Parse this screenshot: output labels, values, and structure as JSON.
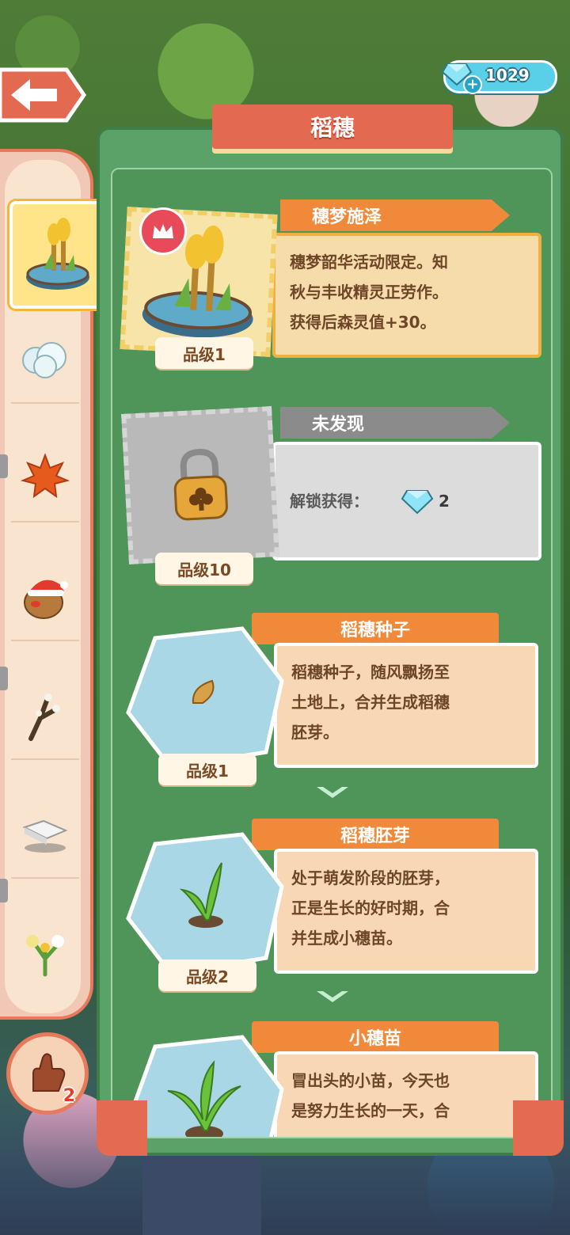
{
  "header": {
    "title": "稻穗",
    "currency_amount": "1029"
  },
  "back_button": {
    "icon": "back-arrow-icon"
  },
  "sidebar": {
    "categories": [
      {
        "name": "rice-ear-island",
        "active": true
      },
      {
        "name": "cotton"
      },
      {
        "name": "maple-leaf"
      },
      {
        "name": "christmas-potato"
      },
      {
        "name": "branch"
      },
      {
        "name": "white-block"
      },
      {
        "name": "flowers"
      }
    ],
    "hand_button_badge": "2"
  },
  "cards": [
    {
      "name": "穗梦施泽",
      "desc_lines": [
        "穗梦韶华活动限定。知",
        "秋与丰收精灵正劳作。",
        "获得后森灵值+30。"
      ],
      "grade": "品级1",
      "badge": "crown-icon",
      "style": "gold"
    },
    {
      "name": "未发现",
      "unlock_label": "解锁获得：",
      "unlock_amount": "2",
      "grade": "品级10",
      "style": "locked"
    },
    {
      "name": "稻穗种子",
      "desc_lines": [
        "稻穗种子，随风飘扬至",
        "土地上，合并生成稻穗",
        "胚芽。"
      ],
      "grade": "品级1",
      "style": "hex"
    },
    {
      "name": "稻穗胚芽",
      "desc_lines": [
        "处于萌发阶段的胚芽，",
        "正是生长的好时期，合",
        "并生成小穗苗。"
      ],
      "grade": "品级2",
      "style": "hex"
    },
    {
      "name": "小穗苗",
      "desc_lines": [
        "冒出头的小苗，今天也",
        "是努力生长的一天，合"
      ],
      "style": "hex"
    }
  ],
  "colors": {
    "panel_green": "#5aa267",
    "banner_red": "#e36a50",
    "tag_orange": "#f08a3a",
    "tag_gray": "#8b8b8b"
  }
}
